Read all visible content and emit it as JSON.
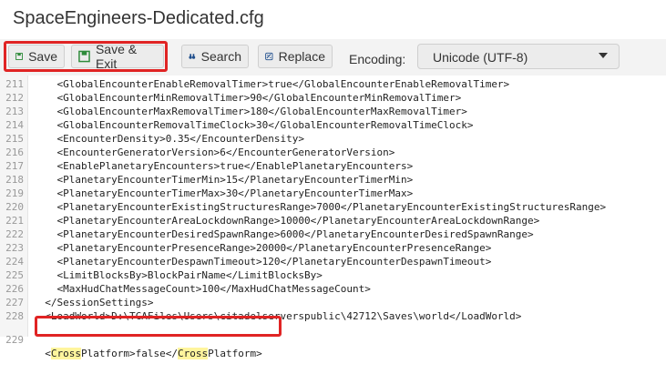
{
  "window": {
    "title": "SpaceEngineers-Dedicated.cfg"
  },
  "toolbar": {
    "save_label": "Save",
    "save_exit_label": "Save & Exit",
    "search_label": "Search",
    "replace_label": "Replace",
    "encoding_label": "Encoding:",
    "encoding_value": "Unicode (UTF-8)"
  },
  "editor": {
    "lines": [
      {
        "n": "211",
        "text": "    <GlobalEncounterEnableRemovalTimer>true</GlobalEncounterEnableRemovalTimer>"
      },
      {
        "n": "212",
        "text": "    <GlobalEncounterMinRemovalTimer>90</GlobalEncounterMinRemovalTimer>"
      },
      {
        "n": "213",
        "text": "    <GlobalEncounterMaxRemovalTimer>180</GlobalEncounterMaxRemovalTimer>"
      },
      {
        "n": "214",
        "text": "    <GlobalEncounterRemovalTimeClock>30</GlobalEncounterRemovalTimeClock>"
      },
      {
        "n": "215",
        "text": "    <EncounterDensity>0.35</EncounterDensity>"
      },
      {
        "n": "216",
        "text": "    <EncounterGeneratorVersion>6</EncounterGeneratorVersion>"
      },
      {
        "n": "217",
        "text": "    <EnablePlanetaryEncounters>true</EnablePlanetaryEncounters>"
      },
      {
        "n": "218",
        "text": "    <PlanetaryEncounterTimerMin>15</PlanetaryEncounterTimerMin>"
      },
      {
        "n": "219",
        "text": "    <PlanetaryEncounterTimerMax>30</PlanetaryEncounterTimerMax>"
      },
      {
        "n": "220",
        "text": "    <PlanetaryEncounterExistingStructuresRange>7000</PlanetaryEncounterExistingStructuresRange>"
      },
      {
        "n": "221",
        "text": "    <PlanetaryEncounterAreaLockdownRange>10000</PlanetaryEncounterAreaLockdownRange>"
      },
      {
        "n": "222",
        "text": "    <PlanetaryEncounterDesiredSpawnRange>6000</PlanetaryEncounterDesiredSpawnRange>"
      },
      {
        "n": "223",
        "text": "    <PlanetaryEncounterPresenceRange>20000</PlanetaryEncounterPresenceRange>"
      },
      {
        "n": "224",
        "text": "    <PlanetaryEncounterDespawnTimeout>120</PlanetaryEncounterDespawnTimeout>"
      },
      {
        "n": "225",
        "text": "    <LimitBlocksBy>BlockPairName</LimitBlocksBy>"
      },
      {
        "n": "226",
        "text": "    <MaxHudChatMessageCount>100</MaxHudChatMessageCount>"
      },
      {
        "n": "227",
        "text": "  </SessionSettings>"
      },
      {
        "n": "228",
        "text": "  <LoadWorld>D:\\TCAFiles\\Users\\citadelserverspublic\\42712\\Saves\\world</LoadWorld>"
      }
    ],
    "last_line": {
      "n": "229",
      "indent": "  ",
      "part1": "<",
      "mark1": "Cross",
      "part2": "Platform>false</",
      "mark2": "Cross",
      "part3": "Platform>"
    }
  },
  "colors": {
    "highlight_box": "#e02424",
    "search_match": "#fff59d",
    "save_icon": "#2e8b3a",
    "search_icon": "#1f4e8c"
  }
}
